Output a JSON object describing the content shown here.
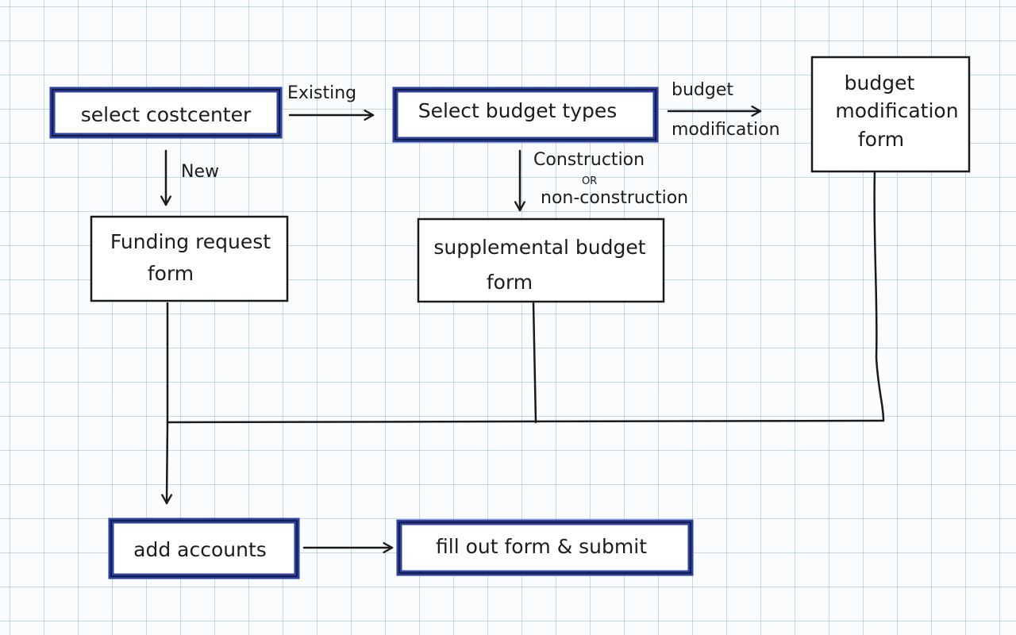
{
  "nodes": {
    "select_cost_center": {
      "lines": [
        "select costcenter"
      ],
      "highlighted": true
    },
    "select_budget_type": {
      "lines": [
        "Select budget types"
      ],
      "highlighted": true
    },
    "budget_modification_form": {
      "lines": [
        "budget",
        "modification",
        "form"
      ],
      "highlighted": false
    },
    "funding_request_form": {
      "lines": [
        "Funding request",
        "form"
      ],
      "highlighted": false
    },
    "supplemental_budget_form": {
      "lines": [
        "supplemental budget",
        "form"
      ],
      "highlighted": false
    },
    "add_accounts": {
      "lines": [
        "add accounts"
      ],
      "highlighted": true
    },
    "fill_out_form": {
      "lines": [
        "fill out form & submit"
      ],
      "highlighted": true
    }
  },
  "edges": {
    "existing": "Existing",
    "new": "New",
    "budget_modification": [
      "budget",
      "modification"
    ],
    "construction": [
      "Construction",
      "OR",
      "non-construction"
    ]
  },
  "colors": {
    "highlight": "#2a3fa8",
    "ink": "#1a1a1a",
    "grid": "#8cbed7",
    "paper": "#fbfcfd"
  }
}
